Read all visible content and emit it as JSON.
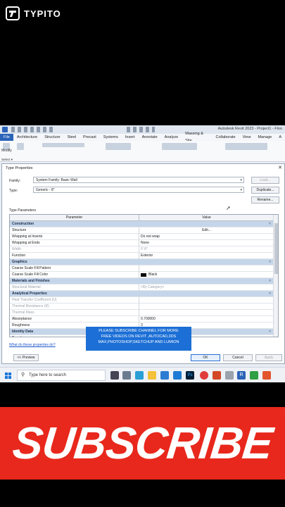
{
  "brand": {
    "name": "TYPITO"
  },
  "app": {
    "title": "Autodesk Revit 2023 - Project1 - Floo"
  },
  "ribbon": {
    "tabs": [
      "File",
      "Architecture",
      "Structure",
      "Steel",
      "Precast",
      "Systems",
      "Insert",
      "Annotate",
      "Analyze",
      "Massing & Site",
      "Collaborate",
      "View",
      "Manage",
      "A"
    ],
    "modify_label": "Modify",
    "select_label": "Select ▾"
  },
  "dialog": {
    "title": "Type Properties",
    "family_label": "Family:",
    "family_value": "System Family: Basic Wall",
    "type_label": "Type:",
    "type_value": "Generic - 8\"",
    "load_label": "Load...",
    "duplicate_label": "Duplicate...",
    "rename_label": "Rename...",
    "section_label": "Type Parameters",
    "col_parameter": "Parameter",
    "col_value": "Value",
    "rows": [
      {
        "kind": "group",
        "param": "Construction",
        "caret": "≈"
      },
      {
        "kind": "row",
        "param": "Structure",
        "value": "Edit...",
        "center": true
      },
      {
        "kind": "row",
        "param": "Wrapping at Inserts",
        "value": "Do not wrap"
      },
      {
        "kind": "row",
        "param": "Wrapping at Ends",
        "value": "None"
      },
      {
        "kind": "gray",
        "param": "Width",
        "value": "0'  8\""
      },
      {
        "kind": "row",
        "param": "Function",
        "value": "Exterior"
      },
      {
        "kind": "group",
        "param": "Graphics",
        "caret": "≈"
      },
      {
        "kind": "row",
        "param": "Coarse Scale Fill Pattern",
        "value": ""
      },
      {
        "kind": "row",
        "param": "Coarse Scale Fill Color",
        "value": "Black",
        "swatch": "#000000"
      },
      {
        "kind": "group",
        "param": "Materials and Finishes",
        "caret": "≈"
      },
      {
        "kind": "gray",
        "param": "Structural Material",
        "value": "<By Category>"
      },
      {
        "kind": "group",
        "param": "Analytical Properties",
        "caret": "≈"
      },
      {
        "kind": "gray",
        "param": "Heat Transfer Coefficient (U)",
        "value": ""
      },
      {
        "kind": "gray",
        "param": "Thermal Resistance (R)",
        "value": ""
      },
      {
        "kind": "gray",
        "param": "Thermal Mass",
        "value": ""
      },
      {
        "kind": "row",
        "param": "Absorptance",
        "value": "0.700000"
      },
      {
        "kind": "row",
        "param": "Roughness",
        "value": "3"
      },
      {
        "kind": "group",
        "param": "Identity Data",
        "caret": "≈"
      },
      {
        "kind": "row",
        "param": "Type Image",
        "value": ""
      }
    ],
    "help_link": "What do these properties do?",
    "preview_label": "<< Preview",
    "ok_label": "OK",
    "cancel_label": "Cancel",
    "apply_label": "Apply"
  },
  "overlay": {
    "text_lines": [
      "PLEASE SUBSCRIBE CHANNEL FOR MORE",
      "FREE VIDEOS ON REVIT ,AUTOCAD,3DS",
      "MAX,PHOTOSHOP,SKETCHUP AND LUMION"
    ]
  },
  "taskbar": {
    "search_placeholder": "Type here to search"
  },
  "cta": {
    "text": "SUBSCRIBE"
  },
  "colors": {
    "accent": "#1c6fd6",
    "cta": "#e8281c"
  }
}
